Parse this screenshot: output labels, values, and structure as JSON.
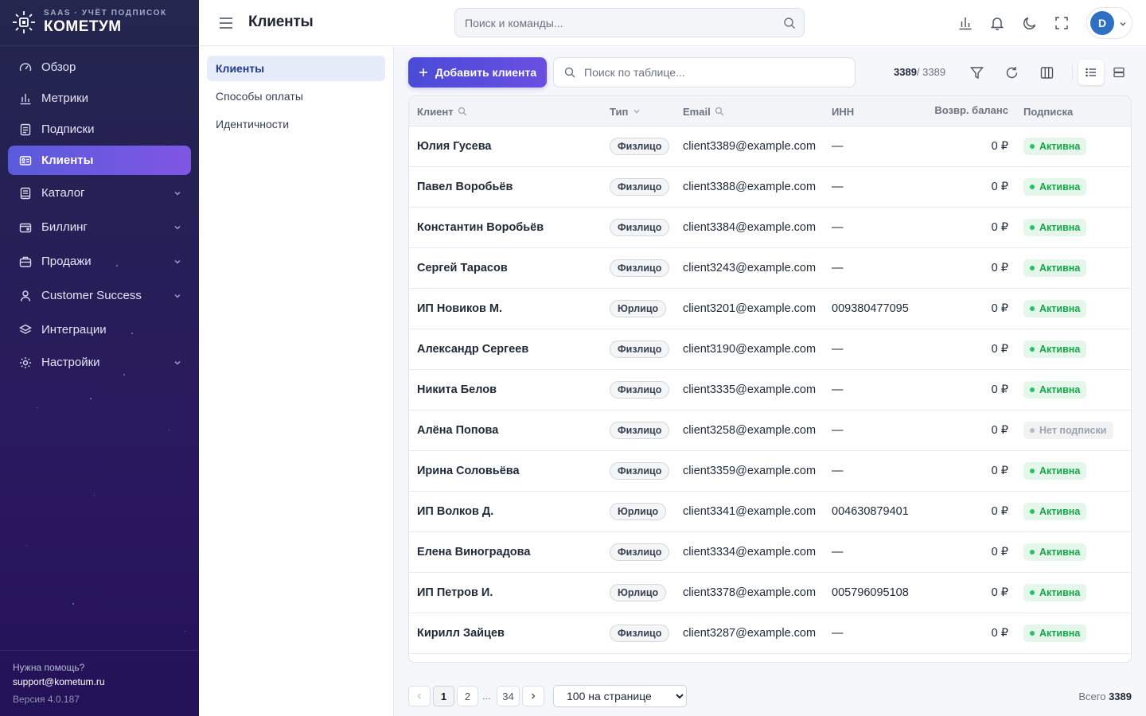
{
  "brand": {
    "subtitle": "SAAS · УЧЁТ ПОДПИСОК",
    "name": "КОМЕТУМ"
  },
  "sidebar": {
    "items": [
      {
        "label": "Обзор",
        "icon": "gauge-icon",
        "active": false,
        "expandable": false
      },
      {
        "label": "Метрики",
        "icon": "bar-chart-icon",
        "active": false,
        "expandable": false
      },
      {
        "label": "Подписки",
        "icon": "document-icon",
        "active": false,
        "expandable": false
      },
      {
        "label": "Клиенты",
        "icon": "id-card-icon",
        "active": true,
        "expandable": false
      },
      {
        "label": "Каталог",
        "icon": "book-icon",
        "active": false,
        "expandable": true
      },
      {
        "label": "Биллинг",
        "icon": "wallet-icon",
        "active": false,
        "expandable": true
      },
      {
        "label": "Продажи",
        "icon": "briefcase-icon",
        "active": false,
        "expandable": true
      },
      {
        "label": "Customer Success",
        "icon": "user-icon",
        "active": false,
        "expandable": true
      },
      {
        "label": "Интеграции",
        "icon": "layers-icon",
        "active": false,
        "expandable": false
      },
      {
        "label": "Настройки",
        "icon": "gear-icon",
        "active": false,
        "expandable": true
      }
    ],
    "footer": {
      "help_question": "Нужна помощь?",
      "help_email": "support@kometum.ru",
      "version": "Версия 4.0.187"
    }
  },
  "header": {
    "title": "Клиенты",
    "search_placeholder": "Поиск и команды...",
    "icons": [
      "bar-chart-icon",
      "bell-icon",
      "moon-icon",
      "fullscreen-icon"
    ],
    "user_initial": "D"
  },
  "subnav": {
    "items": [
      {
        "label": "Клиенты",
        "active": true
      },
      {
        "label": "Способы оплаты",
        "active": false
      },
      {
        "label": "Идентичности",
        "active": false
      }
    ]
  },
  "toolbar": {
    "add_button_label": "Добавить клиента",
    "search_placeholder": "Поиск по таблице...",
    "count_shown": "3389",
    "count_total": "/ 3389"
  },
  "table": {
    "columns": [
      {
        "label": "Клиент",
        "icon": "search-icon"
      },
      {
        "label": "Тип",
        "icon": "chevron-down-icon"
      },
      {
        "label": "Email",
        "icon": "search-icon"
      },
      {
        "label": "ИНН",
        "icon": ""
      },
      {
        "label": "Возвр. баланс",
        "icon": ""
      },
      {
        "label": "Подписка",
        "icon": ""
      }
    ],
    "rows": [
      {
        "name": "Юлия Гусева",
        "type": "Физлицо",
        "email": "client3389@example.com",
        "inn": "—",
        "balance": "0 ₽",
        "status": "Активна",
        "status_kind": "active"
      },
      {
        "name": "Павел Воробьёв",
        "type": "Физлицо",
        "email": "client3388@example.com",
        "inn": "—",
        "balance": "0 ₽",
        "status": "Активна",
        "status_kind": "active"
      },
      {
        "name": "Константин Воробьёв",
        "type": "Физлицо",
        "email": "client3384@example.com",
        "inn": "—",
        "balance": "0 ₽",
        "status": "Активна",
        "status_kind": "active"
      },
      {
        "name": "Сергей Тарасов",
        "type": "Физлицо",
        "email": "client3243@example.com",
        "inn": "—",
        "balance": "0 ₽",
        "status": "Активна",
        "status_kind": "active"
      },
      {
        "name": "ИП Новиков М.",
        "type": "Юрлицо",
        "email": "client3201@example.com",
        "inn": "009380477095",
        "balance": "0 ₽",
        "status": "Активна",
        "status_kind": "active"
      },
      {
        "name": "Александр Сергеев",
        "type": "Физлицо",
        "email": "client3190@example.com",
        "inn": "—",
        "balance": "0 ₽",
        "status": "Активна",
        "status_kind": "active"
      },
      {
        "name": "Никита Белов",
        "type": "Физлицо",
        "email": "client3335@example.com",
        "inn": "—",
        "balance": "0 ₽",
        "status": "Активна",
        "status_kind": "active"
      },
      {
        "name": "Алёна Попова",
        "type": "Физлицо",
        "email": "client3258@example.com",
        "inn": "—",
        "balance": "0 ₽",
        "status": "Нет подписки",
        "status_kind": "none"
      },
      {
        "name": "Ирина Соловьёва",
        "type": "Физлицо",
        "email": "client3359@example.com",
        "inn": "—",
        "balance": "0 ₽",
        "status": "Активна",
        "status_kind": "active"
      },
      {
        "name": "ИП Волков Д.",
        "type": "Юрлицо",
        "email": "client3341@example.com",
        "inn": "004630879401",
        "balance": "0 ₽",
        "status": "Активна",
        "status_kind": "active"
      },
      {
        "name": "Елена Виноградова",
        "type": "Физлицо",
        "email": "client3334@example.com",
        "inn": "—",
        "balance": "0 ₽",
        "status": "Активна",
        "status_kind": "active"
      },
      {
        "name": "ИП Петров И.",
        "type": "Юрлицо",
        "email": "client3378@example.com",
        "inn": "005796095108",
        "balance": "0 ₽",
        "status": "Активна",
        "status_kind": "active"
      },
      {
        "name": "Кирилл Зайцев",
        "type": "Физлицо",
        "email": "client3287@example.com",
        "inn": "—",
        "balance": "0 ₽",
        "status": "Активна",
        "status_kind": "active"
      }
    ]
  },
  "pagination": {
    "pages": [
      "1",
      "2",
      "34"
    ],
    "current": "1",
    "ellipsis": "...",
    "per_page_options": [
      "100 на странице"
    ],
    "per_page_selected": "100 на странице",
    "total_label": "Всего",
    "total_value": "3389"
  },
  "colors": {
    "accent": "#5a5bdc",
    "sidebar_bg": "#261f57",
    "status_active": "#16a34a",
    "avatar": "#2f6fc4"
  }
}
